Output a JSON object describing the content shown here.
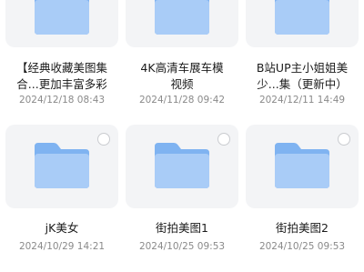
{
  "folders": [
    {
      "title_line1": "【经典收藏美图集",
      "title_line2": "合...更加丰富多彩",
      "date": "2024/12/18 08:43",
      "icon": "folder-icon",
      "selectable": false
    },
    {
      "title_line1": "4K高清车展车模",
      "title_line2": "视频",
      "date": "2024/11/28 09:42",
      "icon": "folder-icon",
      "selectable": false
    },
    {
      "title_line1": "B站UP主小姐姐美",
      "title_line2": "少...集（更新中）",
      "date": "2024/12/11 14:49",
      "icon": "folder-icon",
      "selectable": false
    },
    {
      "title_line1": "jK美女",
      "date": "2024/10/29 14:21",
      "icon": "folder-icon",
      "selectable": true
    },
    {
      "title_line1": "街拍美图1",
      "date": "2024/10/25 09:53",
      "icon": "folder-icon",
      "selectable": true
    },
    {
      "title_line1": "街拍美图2",
      "date": "2024/10/25 09:53",
      "icon": "folder-icon",
      "selectable": true
    }
  ],
  "colors": {
    "card_background": "#f3f4f6",
    "folder_back": "#7fb3f1",
    "folder_front": "#a9ccf7",
    "title_text": "#1b1b1b",
    "date_text": "#8a8a8a"
  }
}
